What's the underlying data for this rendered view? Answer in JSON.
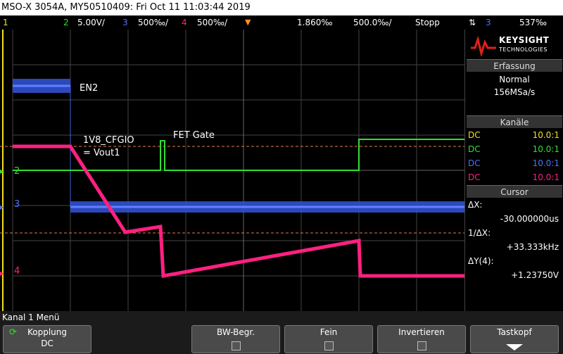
{
  "title": "MSO-X 3054A, MY50510409: Fri Oct 11 11:03:44 2019",
  "status": {
    "ch1_label": "1",
    "ch2_label": "2",
    "ch2_scale": "5.00V/",
    "ch3_label": "3",
    "ch3_scale": "500‰/",
    "ch4_label": "4",
    "ch4_scale": "500‰/",
    "time_pos": "1.860‰",
    "time_scale": "500.0‰/",
    "run_state": "Stopp",
    "trig_icon": "Ӡ",
    "trig_src": "3",
    "trig_level": "537‰"
  },
  "annotations": {
    "en2": "EN2",
    "v1v8": "1V8_CFGIO",
    "vout1": "= Vout1",
    "fetgate": "FET Gate"
  },
  "markers": {
    "ch2": "2",
    "ch3": "3",
    "ch4": "4"
  },
  "brand": {
    "line1": "KEYSIGHT",
    "line2": "TECHNOLOGIES"
  },
  "acquisition": {
    "header": "Erfassung",
    "mode": "Normal",
    "rate": "156MSa/s"
  },
  "channels": {
    "header": "Kanäle",
    "rows": [
      {
        "coupling": "DC",
        "probe": "10.0:1",
        "color": "#f0e020"
      },
      {
        "coupling": "DC",
        "probe": "10.0:1",
        "color": "#30e030"
      },
      {
        "coupling": "DC",
        "probe": "10.0:1",
        "color": "#5070ff"
      },
      {
        "coupling": "DC",
        "probe": "10.0:1",
        "color": "#ff2080"
      }
    ]
  },
  "cursor": {
    "header": "Cursor",
    "dx_label": "ΔX:",
    "dx_value": "-30.000000us",
    "inv_label": "1/ΔX:",
    "inv_value": "+33.333kHz",
    "dy_label": "ΔY(4):",
    "dy_value": "+1.23750V"
  },
  "menu": {
    "title": "Kanal 1 Menü",
    "coupling_label": "Kopplung",
    "coupling_value": "DC",
    "bw_label": "BW-Begr.",
    "fine_label": "Fein",
    "invert_label": "Invertieren",
    "probe_label": "Tastkopf"
  },
  "colors": {
    "ch1": "#f0e020",
    "ch2": "#30e030",
    "ch3": "#5070ff",
    "ch4": "#ff2080",
    "cursor": "#e08040"
  }
}
